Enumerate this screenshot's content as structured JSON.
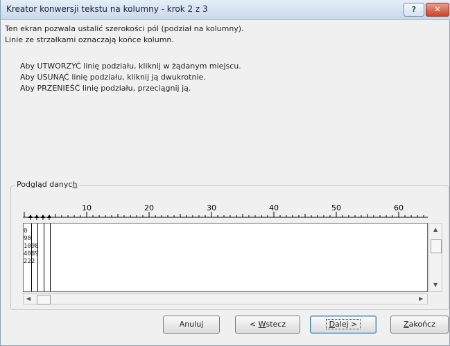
{
  "window": {
    "title": "Kreator konwersji tekstu na kolumny - krok 2 z 3",
    "help": "?",
    "close": "✕"
  },
  "description": [
    "Ten ekran pozwala ustalić szerokości pól (podział na kolumny).",
    "Linie ze strzałkami oznaczają końce kolumn."
  ],
  "instructions": [
    "Aby UTWORZYĆ linię podziału, kliknij w żądanym miejscu.",
    "Aby USUNĄĆ linię podziału, kliknij ją dwukrotnie.",
    "Aby PRZENIEŚĆ linię podziału, przeciągnij ją."
  ],
  "preview": {
    "label_pre": "Podgląd danyc",
    "label_key": "h",
    "ruler_labels": [
      "10",
      "20",
      "30",
      "40",
      "50",
      "60"
    ],
    "column_breaks": [
      2,
      4,
      6,
      8
    ],
    "rows": [
      "0",
      "90",
      "1098",
      "4089",
      "222"
    ]
  },
  "buttons": {
    "cancel": "Anuluj",
    "back_pre": "< ",
    "back_key": "W",
    "back_post": "stecz",
    "next_key": "D",
    "next_post": "alej >",
    "finish_key": "Z",
    "finish_post": "akończ"
  }
}
